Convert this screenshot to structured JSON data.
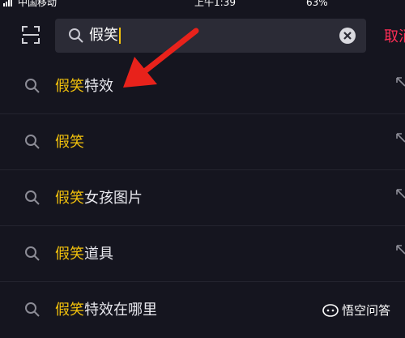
{
  "status_bar": {
    "carrier": "中国移动",
    "time": "上午1:39",
    "battery": "63%"
  },
  "search": {
    "query": "假笑",
    "cancel_label": "取消"
  },
  "suggestions": [
    {
      "highlight": "假笑",
      "rest": "特效"
    },
    {
      "highlight": "假笑",
      "rest": ""
    },
    {
      "highlight": "假笑",
      "rest": "女孩图片"
    },
    {
      "highlight": "假笑",
      "rest": "道具"
    },
    {
      "highlight": "假笑",
      "rest": "特效在哪里"
    }
  ],
  "watermark": {
    "text": "悟空问答"
  },
  "colors": {
    "background": "#15151f",
    "highlight": "#f3c20c",
    "cancel": "#ff2d55",
    "arrow": "#e8221b"
  }
}
